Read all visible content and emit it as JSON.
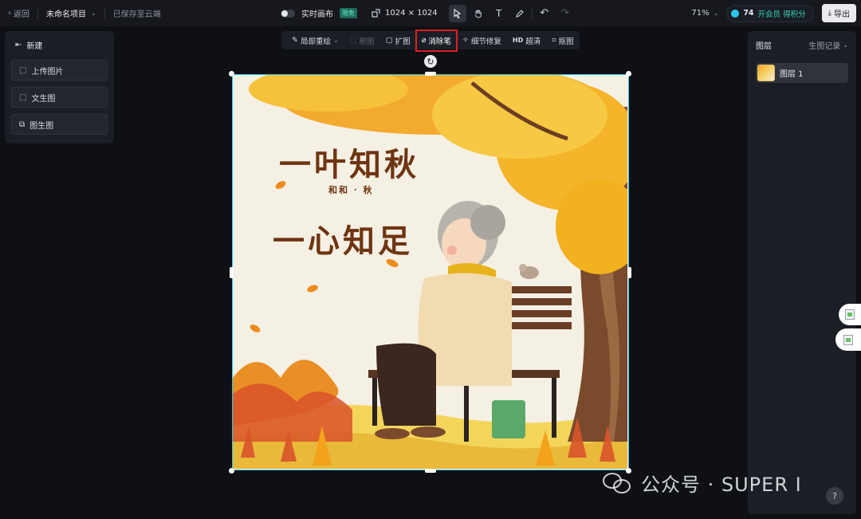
{
  "topbar": {
    "back_label": "返回",
    "project_name": "未命名项目",
    "save_status": "已保存至云端",
    "realtime_label": "实时画布",
    "realtime_badge": "限免",
    "canvas_size": "1024 × 1024",
    "zoom": "71%",
    "points": "74",
    "points_link": "开会员 得积分",
    "export_label": "导出"
  },
  "left_panel": {
    "new_label": "新建",
    "buttons": [
      "上传图片",
      "文生图",
      "图生图"
    ]
  },
  "canvas_toolbar": {
    "items": [
      {
        "label": "局部重绘",
        "icon": "brush-icon"
      },
      {
        "label": "删图",
        "icon": "delete-icon",
        "disabled": true
      },
      {
        "label": "扩图",
        "icon": "expand-icon"
      },
      {
        "label": "消除笔",
        "icon": "eraser-icon",
        "highlighted": true
      },
      {
        "label": "细节修复",
        "icon": "repair-icon"
      },
      {
        "label": "超清",
        "icon": "hd-icon"
      },
      {
        "label": "抠图",
        "icon": "cutout-icon"
      }
    ]
  },
  "artwork": {
    "title_line1": "一叶知秋",
    "subtitle": "和和 · 秋",
    "title_line2": "一心知足"
  },
  "right_panel": {
    "title": "图层",
    "history_tab": "生图记录",
    "layers": [
      "图层 1"
    ],
    "help": "?"
  },
  "watermark": {
    "text": "公众号 · SUPER I"
  },
  "colors": {
    "accent": "#2ac6e8",
    "highlight_box": "#e02020",
    "brand_teal": "#35d5b8"
  }
}
